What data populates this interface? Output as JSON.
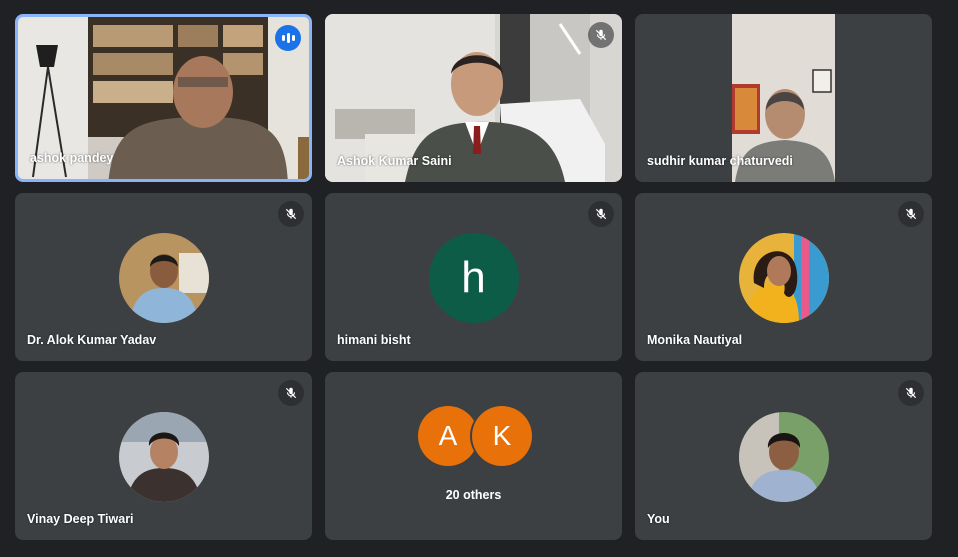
{
  "colors": {
    "background": "#202124",
    "tile": "#3c4043",
    "speaking_border": "#8ab4f8",
    "speaking_badge": "#1a73e8",
    "himani_avatar": "#0d5c48",
    "others_avatar": "#e8710a"
  },
  "participants": [
    {
      "name": "ashok pandey",
      "speaking": true
    },
    {
      "name": "Ashok Kumar Saini",
      "muted": true
    },
    {
      "name": "sudhir kumar chaturvedi"
    },
    {
      "name": "Dr. Alok Kumar Yadav",
      "muted": true
    },
    {
      "name": "himani bisht",
      "muted": true,
      "initial": "h"
    },
    {
      "name": "Monika Nautiyal",
      "muted": true
    },
    {
      "name": "Vinay Deep Tiwari",
      "muted": true
    },
    {
      "name": "You",
      "muted": true
    }
  ],
  "others": {
    "initials": [
      "A",
      "K"
    ],
    "label": "20 others"
  }
}
